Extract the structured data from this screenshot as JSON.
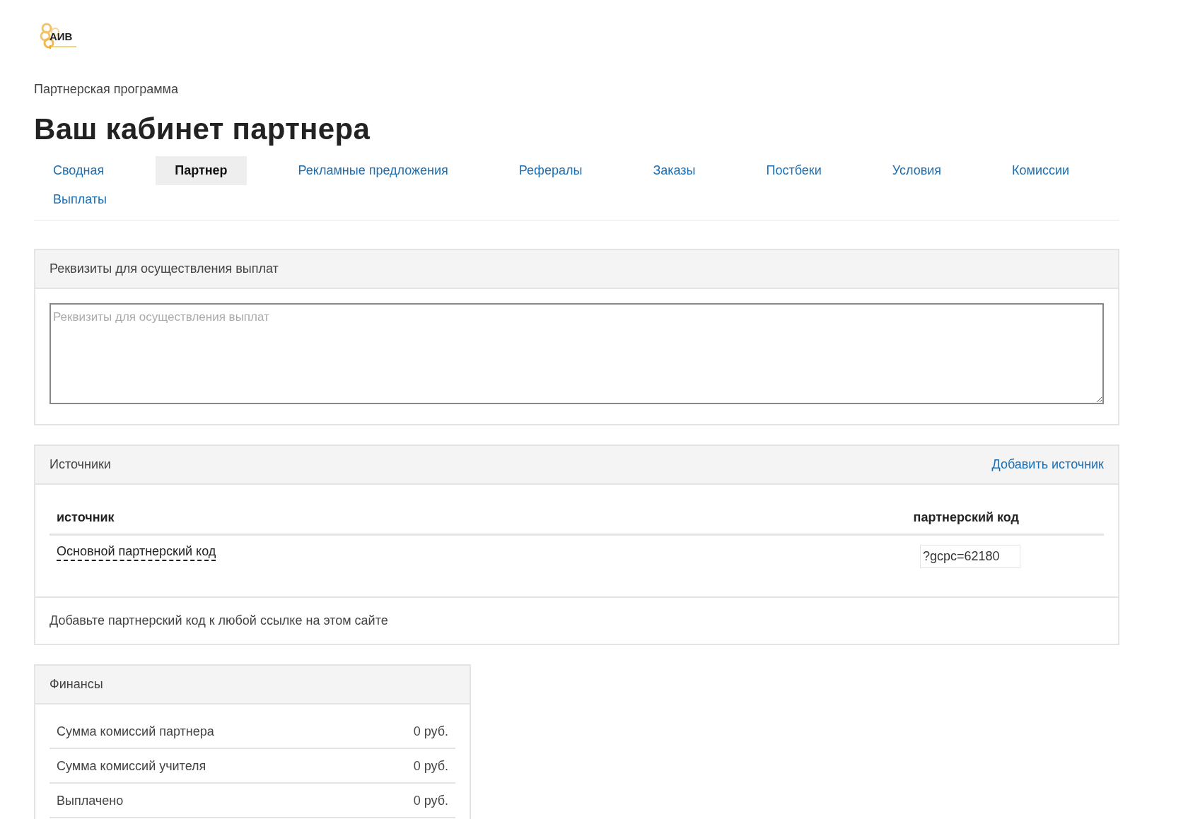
{
  "logo": {
    "text": "АИВ"
  },
  "breadcrumb": "Партнерская программа",
  "title": "Ваш кабинет партнера",
  "tabs": [
    {
      "label": "Сводная",
      "selected": false
    },
    {
      "label": "Партнер",
      "selected": true
    },
    {
      "label": "Рекламные предложения",
      "selected": false
    },
    {
      "label": "Рефералы",
      "selected": false
    },
    {
      "label": "Заказы",
      "selected": false
    },
    {
      "label": "Постбеки",
      "selected": false
    },
    {
      "label": "Условия",
      "selected": false
    },
    {
      "label": "Комиссии",
      "selected": false
    },
    {
      "label": "Выплаты",
      "selected": false
    }
  ],
  "payment_details": {
    "heading": "Реквизиты для осуществления выплат",
    "placeholder": "Реквизиты для осуществления выплат"
  },
  "sources": {
    "heading": "Источники",
    "add_link": "Добавить источник",
    "columns": [
      "источник",
      "партнерский код"
    ],
    "rows": [
      {
        "source": "Основной партнерский код",
        "code": "?gcpc=62180"
      }
    ],
    "footer": "Добавьте партнерский код к любой ссылке на этом сайте"
  },
  "finances": {
    "heading": "Финансы",
    "rows": [
      {
        "label": "Сумма комиссий партнера",
        "value": "0 руб."
      },
      {
        "label": "Сумма комиссий учителя",
        "value": "0 руб."
      },
      {
        "label": "Выплачено",
        "value": "0 руб."
      }
    ]
  }
}
